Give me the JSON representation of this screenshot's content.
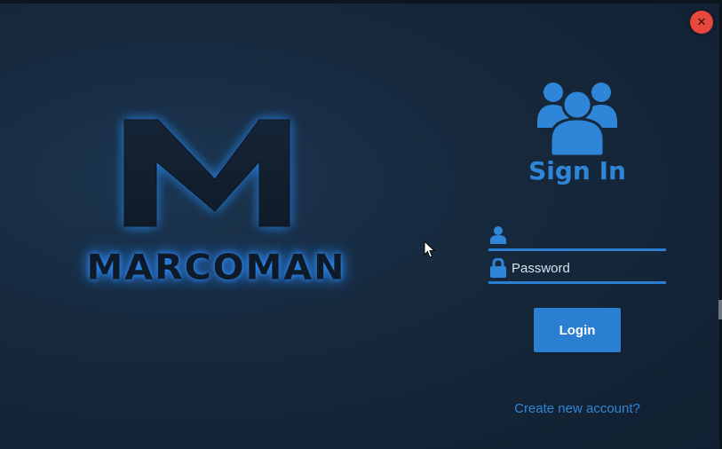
{
  "window": {
    "close_icon": "close-icon",
    "accent_color": "#2a7fd2",
    "close_color": "#e8473c"
  },
  "logo": {
    "letter": "M",
    "wordmark": "MARCOMAN",
    "glow_color": "#2f8fff"
  },
  "signin": {
    "icon": "users-group-icon",
    "title": "Sign In",
    "username": {
      "icon": "user-icon",
      "value": "",
      "placeholder": ""
    },
    "password": {
      "icon": "lock-icon",
      "value": "",
      "placeholder": "Password"
    },
    "login_label": "Login",
    "create_account_label": "Create new account?"
  }
}
